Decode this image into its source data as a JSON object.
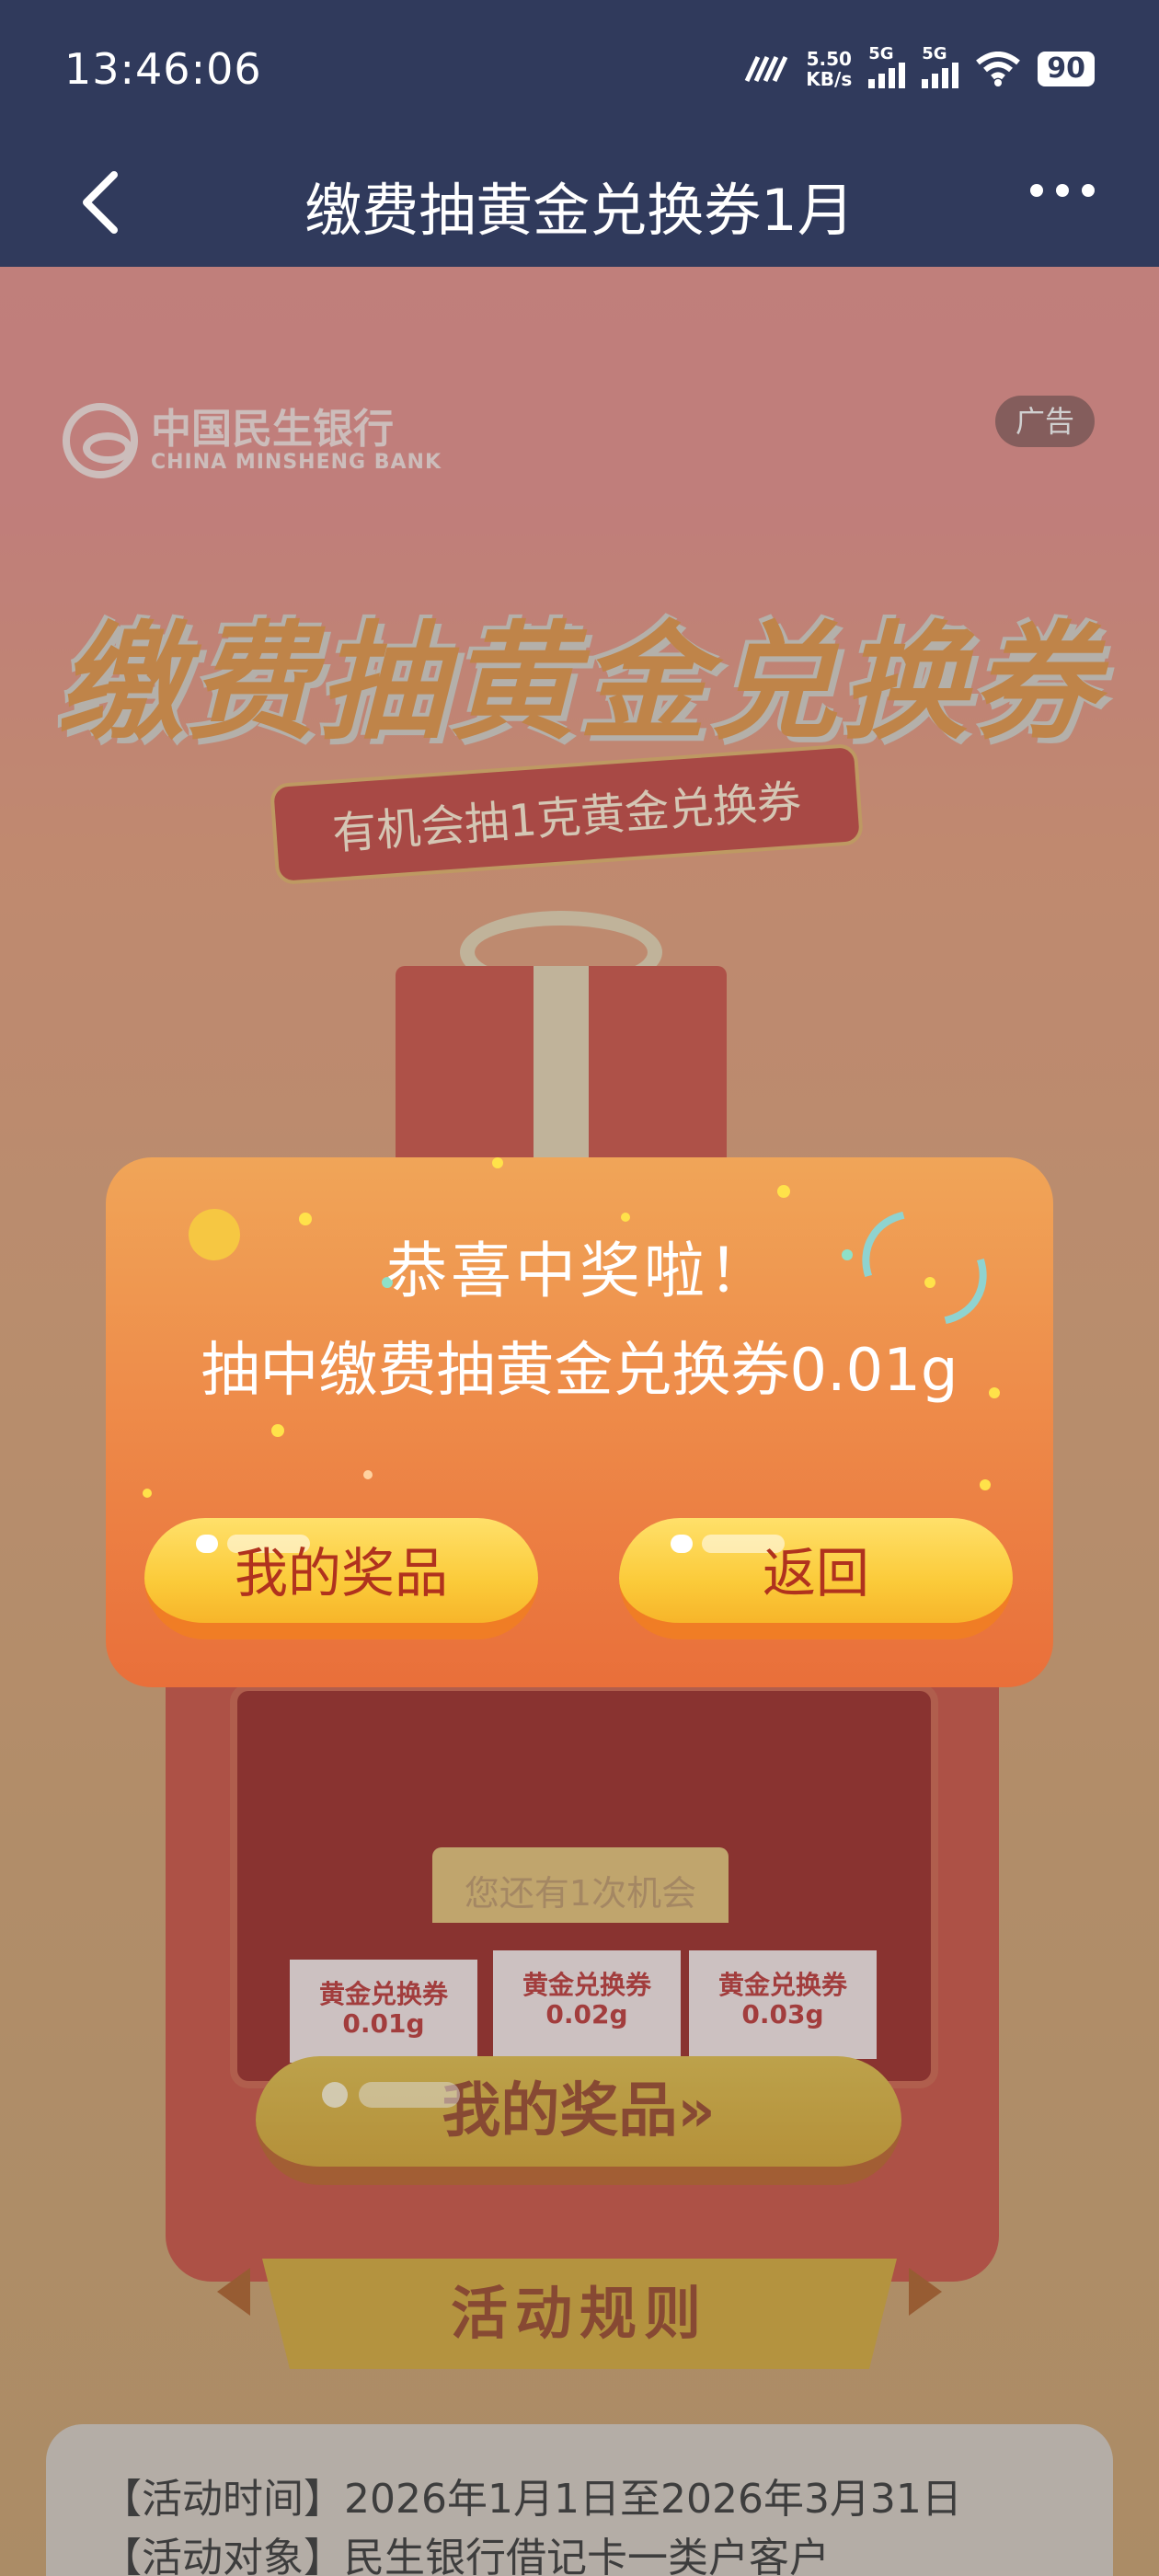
{
  "status_bar": {
    "time": "13:46:06",
    "speed_value": "5.50",
    "speed_unit": "KB/s",
    "signal1_label": "5G",
    "signal2_label": "5G",
    "battery": "90"
  },
  "nav": {
    "title": "缴费抽黄金兑换券1月"
  },
  "promo": {
    "bank_name_cn": "中国民生银行",
    "bank_name_en": "CHINA MINSHENG BANK",
    "ad_badge": "广告",
    "headline": "缴费抽黄金兑换券",
    "ribbon_text": "有机会抽1克黄金兑换券",
    "cards": [
      {
        "name": "黄金兑换券",
        "amount": "0.01g"
      },
      {
        "name": "黄金兑换券",
        "amount": "0.02g"
      },
      {
        "name": "黄金兑换券",
        "amount": "0.03g"
      }
    ],
    "chances_text": "您还有1次机会",
    "my_prizes_button": "我的奖品»",
    "rules_title": "活动规则",
    "rules": [
      "【活动时间】2026年1月1日至2026年3月31日",
      "【活动对象】民生银行借记卡一类户客户"
    ]
  },
  "modal": {
    "title": "恭喜中奖啦！",
    "message": "抽中缴费抽黄金兑换券0.01g",
    "btn_my_prizes": "我的奖品",
    "btn_back": "返回"
  }
}
